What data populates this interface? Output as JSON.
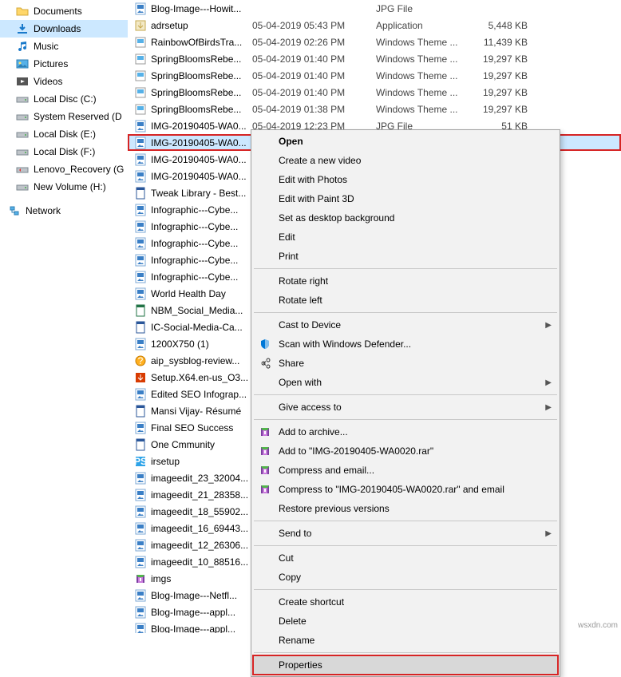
{
  "nav": [
    {
      "label": "Documents",
      "icon": "folder"
    },
    {
      "label": "Downloads",
      "icon": "downloads",
      "selected": true
    },
    {
      "label": "Music",
      "icon": "music"
    },
    {
      "label": "Pictures",
      "icon": "pictures"
    },
    {
      "label": "Videos",
      "icon": "videos"
    },
    {
      "label": "Local Disc (C:)",
      "icon": "drive"
    },
    {
      "label": "System Reserved (D",
      "icon": "drive"
    },
    {
      "label": "Local Disk (E:)",
      "icon": "drive"
    },
    {
      "label": "Local Disk (F:)",
      "icon": "drive"
    },
    {
      "label": "Lenovo_Recovery (G",
      "icon": "recovery"
    },
    {
      "label": "New Volume (H:)",
      "icon": "drive"
    },
    {
      "label": "",
      "icon": "spacer"
    },
    {
      "label": "Network",
      "icon": "network",
      "indent": true
    }
  ],
  "files": [
    {
      "name": "Blog-Image---Howit...",
      "date": "",
      "type": "JPG File",
      "size": "",
      "icon": "jpg"
    },
    {
      "name": "adrsetup",
      "date": "05-04-2019 05:43 PM",
      "type": "Application",
      "size": "5,448 KB",
      "icon": "app"
    },
    {
      "name": "RainbowOfBirdsTra...",
      "date": "05-04-2019 02:26 PM",
      "type": "Windows Theme ...",
      "size": "11,439 KB",
      "icon": "theme"
    },
    {
      "name": "SpringBloomsRebe...",
      "date": "05-04-2019 01:40 PM",
      "type": "Windows Theme ...",
      "size": "19,297 KB",
      "icon": "theme"
    },
    {
      "name": "SpringBloomsRebe...",
      "date": "05-04-2019 01:40 PM",
      "type": "Windows Theme ...",
      "size": "19,297 KB",
      "icon": "theme"
    },
    {
      "name": "SpringBloomsRebe...",
      "date": "05-04-2019 01:40 PM",
      "type": "Windows Theme ...",
      "size": "19,297 KB",
      "icon": "theme"
    },
    {
      "name": "SpringBloomsRebe...",
      "date": "05-04-2019 01:38 PM",
      "type": "Windows Theme ...",
      "size": "19,297 KB",
      "icon": "theme"
    },
    {
      "name": "IMG-20190405-WA0...",
      "date": "05-04-2019 12:23 PM",
      "type": "JPG File",
      "size": "51 KB",
      "icon": "jpg"
    },
    {
      "name": "IMG-20190405-WA0...",
      "date": "",
      "type": "",
      "size": "",
      "icon": "jpg",
      "selected": true,
      "highlight": true
    },
    {
      "name": "IMG-20190405-WA0...",
      "icon": "jpg"
    },
    {
      "name": "IMG-20190405-WA0...",
      "icon": "jpg"
    },
    {
      "name": "Tweak Library - Best...",
      "icon": "doc"
    },
    {
      "name": "Infographic---Cybe...",
      "icon": "jpg"
    },
    {
      "name": "Infographic---Cybe...",
      "icon": "jpg"
    },
    {
      "name": "Infographic---Cybe...",
      "icon": "jpg"
    },
    {
      "name": "Infographic---Cybe...",
      "icon": "jpg"
    },
    {
      "name": "Infographic---Cybe...",
      "icon": "jpg"
    },
    {
      "name": "World Health Day",
      "icon": "jpg"
    },
    {
      "name": "NBM_Social_Media...",
      "icon": "xls"
    },
    {
      "name": "IC-Social-Media-Ca...",
      "icon": "doc"
    },
    {
      "name": "1200X750 (1)",
      "icon": "jpg"
    },
    {
      "name": "aip_sysblog-review...",
      "icon": "chm"
    },
    {
      "name": "Setup.X64.en-us_O3...",
      "icon": "setup"
    },
    {
      "name": "Edited SEO Infograp...",
      "icon": "jpg"
    },
    {
      "name": "Mansi Vijay- Résumé",
      "icon": "doc"
    },
    {
      "name": "Final SEO Success",
      "icon": "jpg"
    },
    {
      "name": "One Cmmunity",
      "icon": "doc"
    },
    {
      "name": "irsetup",
      "icon": "ps"
    },
    {
      "name": "imageedit_23_32004...",
      "icon": "jpg"
    },
    {
      "name": "imageedit_21_28358...",
      "icon": "jpg"
    },
    {
      "name": "imageedit_18_55902...",
      "icon": "jpg"
    },
    {
      "name": "imageedit_16_69443...",
      "icon": "jpg"
    },
    {
      "name": "imageedit_12_26306...",
      "icon": "jpg"
    },
    {
      "name": "imageedit_10_88516...",
      "icon": "jpg"
    },
    {
      "name": "imgs",
      "icon": "rar"
    },
    {
      "name": "Blog-Image---Netfl...",
      "icon": "jpg"
    },
    {
      "name": "Blog-Image---appl...",
      "icon": "jpg"
    },
    {
      "name": "Blog-Image---appl...",
      "icon": "jpg"
    }
  ],
  "ctx": [
    {
      "label": "Open",
      "bold": true
    },
    {
      "label": "Create a new video"
    },
    {
      "label": "Edit with Photos"
    },
    {
      "label": "Edit with Paint 3D"
    },
    {
      "label": "Set as desktop background"
    },
    {
      "label": "Edit"
    },
    {
      "label": "Print"
    },
    {
      "sep": true
    },
    {
      "label": "Rotate right"
    },
    {
      "label": "Rotate left"
    },
    {
      "sep": true
    },
    {
      "label": "Cast to Device",
      "arrow": true
    },
    {
      "label": "Scan with Windows Defender...",
      "icon": "defender"
    },
    {
      "label": "Share",
      "icon": "share"
    },
    {
      "label": "Open with",
      "arrow": true
    },
    {
      "sep": true
    },
    {
      "label": "Give access to",
      "arrow": true
    },
    {
      "sep": true
    },
    {
      "label": "Add to archive...",
      "icon": "rar"
    },
    {
      "label": "Add to \"IMG-20190405-WA0020.rar\"",
      "icon": "rar"
    },
    {
      "label": "Compress and email...",
      "icon": "rar"
    },
    {
      "label": "Compress to \"IMG-20190405-WA0020.rar\" and email",
      "icon": "rar"
    },
    {
      "label": "Restore previous versions"
    },
    {
      "sep": true
    },
    {
      "label": "Send to",
      "arrow": true
    },
    {
      "sep": true
    },
    {
      "label": "Cut"
    },
    {
      "label": "Copy"
    },
    {
      "sep": true
    },
    {
      "label": "Create shortcut"
    },
    {
      "label": "Delete"
    },
    {
      "label": "Rename"
    },
    {
      "sep": true
    },
    {
      "label": "Properties",
      "hover": true
    }
  ],
  "watermark": "wsxdn.com"
}
